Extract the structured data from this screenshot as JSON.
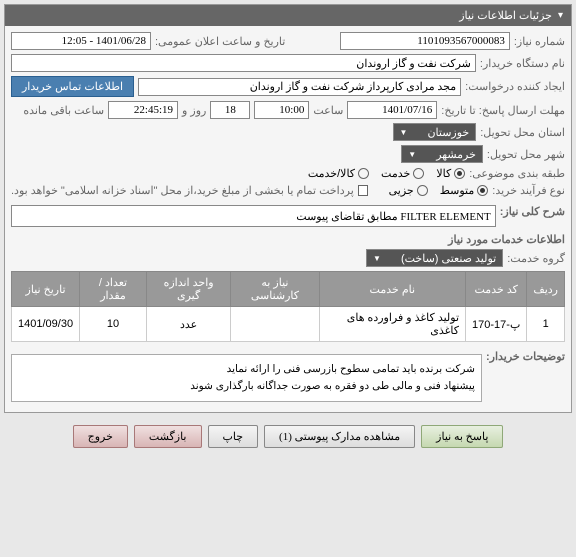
{
  "header": {
    "title": "جزئیات اطلاعات نیاز"
  },
  "fields": {
    "need_number_label": "شماره نیاز:",
    "need_number_value": "1101093567000083",
    "public_announce_label": "تاریخ و ساعت اعلان عمومی:",
    "public_announce_value": "1401/06/28 - 12:05",
    "buyer_org_label": "نام دستگاه خریدار:",
    "buyer_org_value": "شرکت نفت و گاز اروندان",
    "creator_label": "ایجاد کننده درخواست:",
    "creator_value": "مجد مرادی کارپرداز شرکت نفت و گاز اروندان",
    "contact_btn": "اطلاعات تماس خریدار",
    "deadline_label": "مهلت ارسال پاسخ: تا تاریخ:",
    "deadline_date": "1401/07/16",
    "hour_label": "ساعت",
    "deadline_time": "10:00",
    "days_label": "روز و",
    "days_value": "18",
    "remaining_time": "22:45:19",
    "remaining_label": "ساعت باقی مانده",
    "province_label": "استان محل تحویل:",
    "province_value": "خوزستان",
    "city_label": "شهر محل تحویل:",
    "city_value": "خرمشهر",
    "category_label": "طبقه بندی موضوعی:",
    "process_type_label": "نوع فرآیند خرید:",
    "payment_note": "پرداخت تمام یا بخشی از مبلغ خرید،از محل \"اسناد خزانه اسلامی\" خواهد بود."
  },
  "radios": {
    "cat_goods": "کالا",
    "cat_service": "خدمت",
    "cat_both": "کالا/خدمت",
    "proc_medium": "متوسط",
    "proc_partial": "جزیی"
  },
  "description": {
    "label": "شرح کلی نیاز:",
    "value": "FILTER ELEMENT مطابق تقاضای پیوست"
  },
  "services": {
    "section_title": "اطلاعات خدمات مورد نیاز",
    "group_label": "گروه خدمت:",
    "group_value": "تولید صنعتی (ساخت)",
    "headers": {
      "row": "ردیف",
      "code": "کد خدمت",
      "name": "نام خدمت",
      "expert": "نیاز به کارشناسی",
      "unit": "واحد اندازه گیری",
      "qty": "تعداد / مقدار",
      "date": "تاریخ نیاز"
    },
    "rows": [
      {
        "idx": "1",
        "code": "پ-17-170",
        "name": "تولید کاغذ و فراورده های کاغذی",
        "expert": "",
        "unit": "عدد",
        "qty": "10",
        "date": "1401/09/30"
      }
    ]
  },
  "buyer_notes": {
    "label": "توضیحات خریدار:",
    "line1": "شرکت برنده باید تمامی سطوح بازرسی فنی را ارائه نماید",
    "line2": "پیشنهاد فنی و مالی طی دو فقره به صورت جداگانه بارگذاری شوند"
  },
  "buttons": {
    "reply": "پاسخ به نیاز",
    "attachments": "مشاهده مدارک پیوستی (1)",
    "print": "چاپ",
    "back": "بازگشت",
    "exit": "خروج"
  }
}
